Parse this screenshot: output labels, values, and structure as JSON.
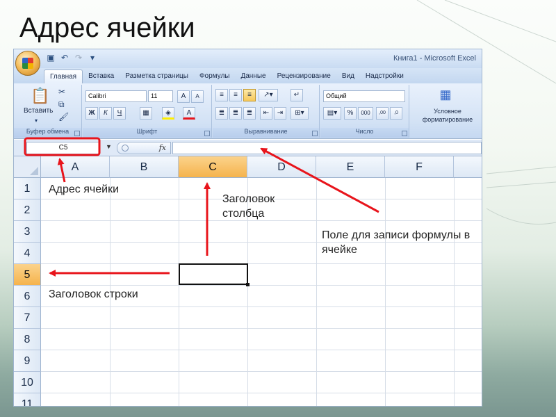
{
  "slide": {
    "title": "Адрес ячейки"
  },
  "window": {
    "title": "Книга1 - Microsoft Excel"
  },
  "tabs": [
    "Главная",
    "Вставка",
    "Разметка страницы",
    "Формулы",
    "Данные",
    "Рецензирование",
    "Вид",
    "Надстройки"
  ],
  "ribbon": {
    "clipboard": {
      "paste_label": "Вставить",
      "group_label": "Буфер обмена"
    },
    "font": {
      "font_name": "Calibri",
      "font_size": "11",
      "bold": "Ж",
      "italic": "К",
      "underline": "Ч",
      "group_label": "Шрифт"
    },
    "alignment": {
      "group_label": "Выравнивание"
    },
    "number": {
      "format": "Общий",
      "percent": "%",
      "thousands": "000",
      "group_label": "Число"
    },
    "styles": {
      "cond_format_line1": "Условное",
      "cond_format_line2": "форматирование"
    }
  },
  "formula_bar": {
    "name_box": "C5",
    "fx": "fx",
    "formula": ""
  },
  "columns": [
    "A",
    "B",
    "C",
    "D",
    "E",
    "F"
  ],
  "rows": [
    "1",
    "2",
    "3",
    "4",
    "5",
    "6",
    "7",
    "8",
    "9",
    "10",
    "11"
  ],
  "selected_cell": "C5",
  "annotations": {
    "cell_address": "Адрес ячейки",
    "column_header_1": "Заголовок",
    "column_header_2": "столбца",
    "formula_field_1": "Поле для записи формулы в",
    "formula_field_2": "ячейке",
    "row_header": "Заголовок строки"
  },
  "colors": {
    "arrow": "#e8141b",
    "selected_header": "#f5b34c",
    "ribbon": "#d3e2f5"
  }
}
